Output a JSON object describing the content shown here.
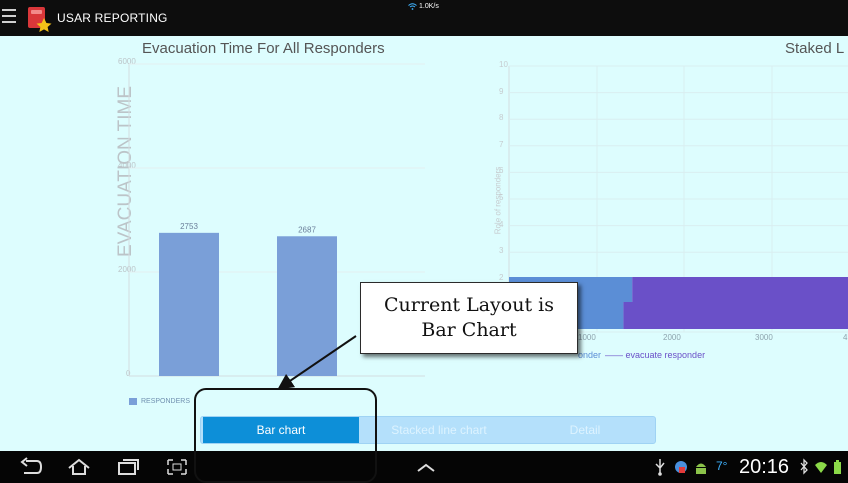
{
  "app": {
    "title": "USAR REPORTING",
    "net_speed": "1.0K/s"
  },
  "bar_chart_view": {
    "title": "Evacuation Time For All Responders",
    "legend": "RESPONDERS"
  },
  "stacked_view": {
    "title_partial": "Staked L",
    "y_axis_label": "Role of responders",
    "legend_1_partial": "onder",
    "legend_2": "evacuate responder"
  },
  "tabs": [
    {
      "label": "Bar chart",
      "active": true
    },
    {
      "label": "Stacked line chart",
      "active": false
    },
    {
      "label": "Detail",
      "active": false
    }
  ],
  "callout": {
    "line1": "Current Layout is",
    "line2": "Bar Chart"
  },
  "status_bar": {
    "time": "20:16",
    "temperature": "7°"
  },
  "colors": {
    "content_bg": "#ddfdfe",
    "bar_fill": "#7a9fd8",
    "tab_active": "#0d8fd8",
    "stack_series_1": "#5b8ed6",
    "stack_series_2": "#6a50c8"
  },
  "chart_data": [
    {
      "type": "bar",
      "title": "Evacuation Time For All Responders",
      "ylabel": "EVACUATION TIME",
      "xlabel": "",
      "ylim": [
        0,
        6000
      ],
      "yticks": [
        "0",
        "2000",
        "4000",
        "6000"
      ],
      "categories": [
        "",
        ""
      ],
      "series": [
        {
          "name": "RESPONDERS",
          "values": [
            2753,
            2687
          ]
        }
      ],
      "data_labels": [
        "2753",
        "2687"
      ],
      "legend_position": "bottom-left"
    },
    {
      "type": "bar",
      "orientation": "horizontal",
      "stacked": true,
      "title": "Staked L",
      "ylabel": "Role of responders",
      "ylim": [
        0,
        10
      ],
      "yticks": [
        "0",
        "1",
        "2",
        "3",
        "4",
        "5",
        "6",
        "7",
        "8",
        "9",
        "10"
      ],
      "xticks": [
        "1000",
        "2000",
        "3000",
        "4"
      ],
      "series": [
        {
          "name": "onder",
          "values": [
            1400,
            1300
          ]
        },
        {
          "name": "evacuate responder",
          "values": [
            2600,
            2700
          ]
        }
      ],
      "legend_position": "bottom"
    }
  ]
}
